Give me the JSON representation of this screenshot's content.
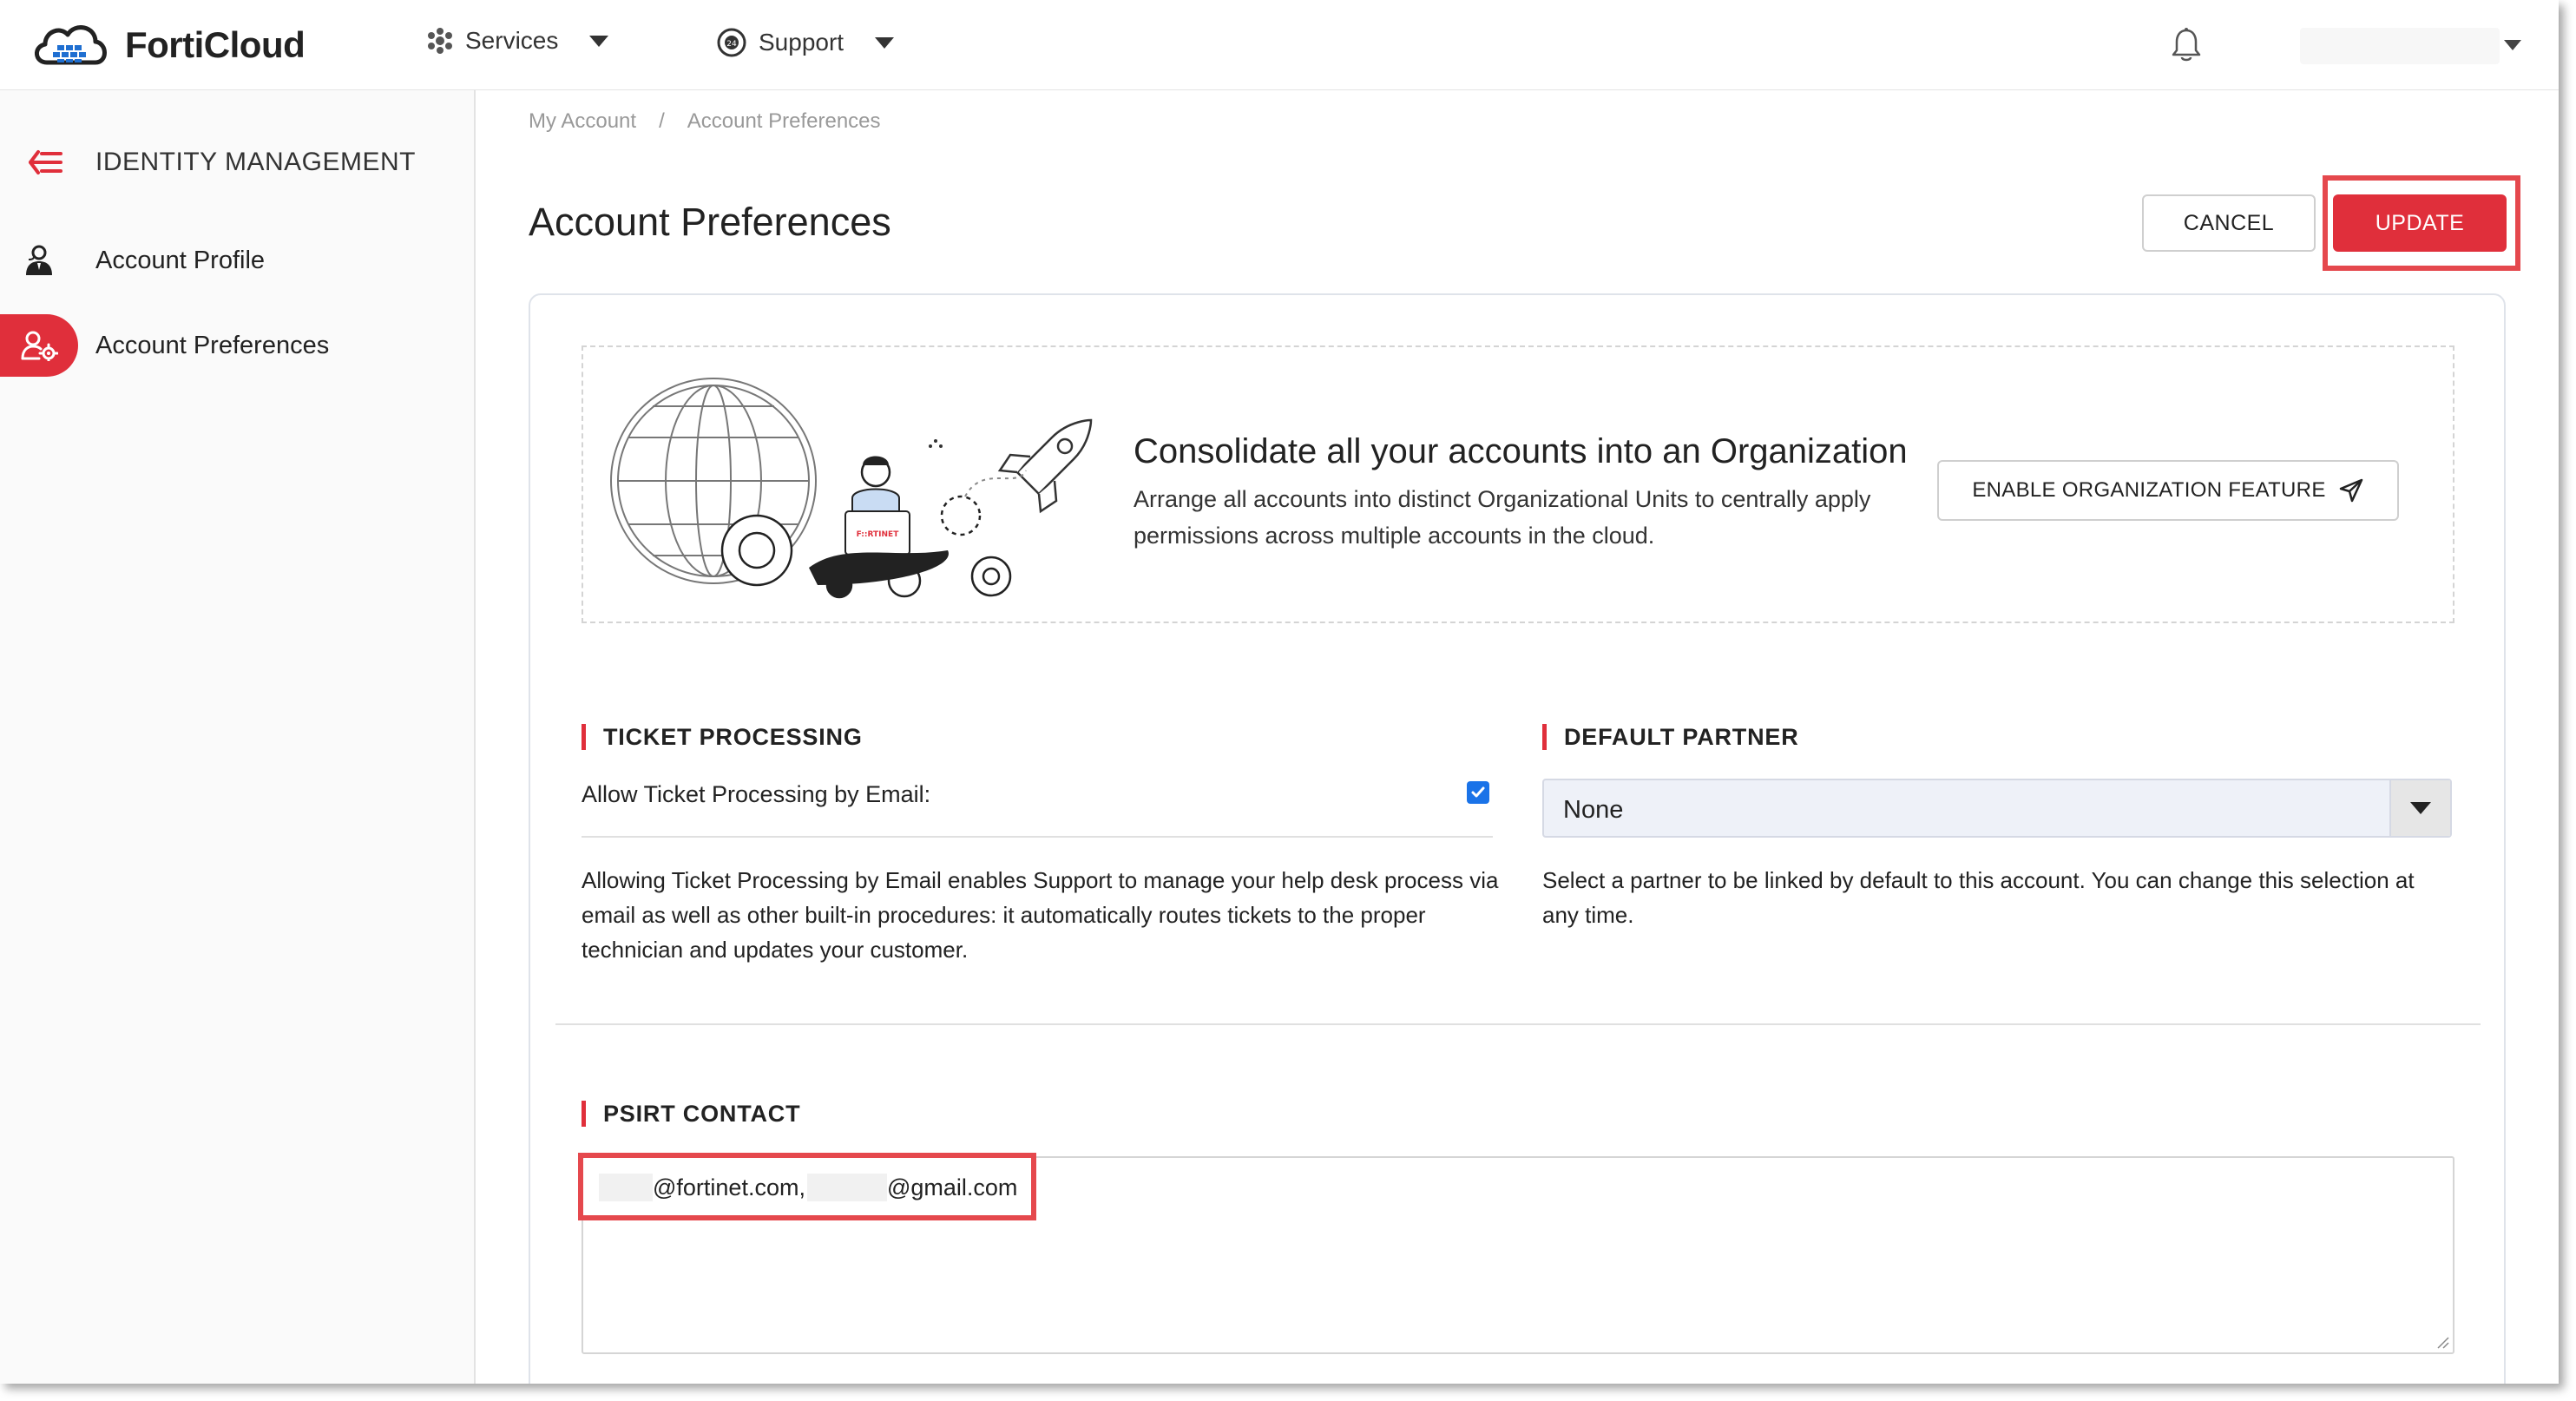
{
  "topbar": {
    "brand": "FortiCloud",
    "nav": [
      {
        "label": "Services",
        "icon": "services-icon"
      },
      {
        "label": "Support",
        "icon": "support-icon"
      }
    ],
    "notifications_icon": "bell-icon"
  },
  "sidebar": {
    "heading": "IDENTITY MANAGEMENT",
    "items": [
      {
        "label": "Account Profile",
        "icon": "user-profile-icon",
        "active": false
      },
      {
        "label": "Account Preferences",
        "icon": "user-settings-icon",
        "active": true
      }
    ]
  },
  "breadcrumb": {
    "items": [
      "My Account",
      "Account Preferences"
    ],
    "separator": "/"
  },
  "page": {
    "title": "Account Preferences",
    "cancel_label": "CANCEL",
    "update_label": "UPDATE"
  },
  "promo": {
    "title": "Consolidate all your accounts into an Organization",
    "text": "Arrange all accounts into distinct Organizational Units to centrally apply permissions across multiple accounts in the cloud.",
    "button_label": "ENABLE ORGANIZATION FEATURE",
    "illustration_badge": "F::RTINET"
  },
  "ticket_processing": {
    "title": "TICKET PROCESSING",
    "label": "Allow Ticket Processing by Email:",
    "checked": true,
    "help": "Allowing Ticket Processing by Email enables Support to manage your help desk process via email as well as other built-in procedures: it automatically routes tickets to the proper technician and updates your customer."
  },
  "default_partner": {
    "title": "DEFAULT PARTNER",
    "selected": "None",
    "help": "Select a partner to be linked by default to this account. You can change this selection at any time."
  },
  "psirt_contact": {
    "title": "PSIRT CONTACT",
    "email_1_domain": "@fortinet.com,",
    "email_2_domain": "@gmail.com"
  },
  "colors": {
    "accent": "#e02f3b",
    "highlight": "#e5484d",
    "checkbox": "#1a73e8"
  }
}
